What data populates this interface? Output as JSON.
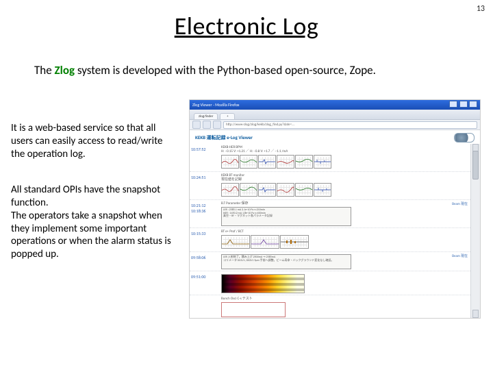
{
  "page_number": "13",
  "title": "Electronic Log",
  "intro_prefix": "The ",
  "intro_zlog": "Zlog",
  "intro_suffix": " system is developed with the Python-based open-source, Zope.",
  "para1": "It is a web-based service so that all users can easily access to read/write the operation log.",
  "para2": "All standard OPIs have the snapshot function.\nThe operators take a snapshot when they implement some important operations or when the alarm status is popped up.",
  "screenshot": {
    "window_title": "Zlog Viewer - Mozilla Firefox",
    "tab_label": "zlog.finder",
    "tab_plus": "+",
    "url": "http://www-zlog/zlog/kekb/zlog_find.py?date=...",
    "header_left": "KEKB 運転記録 e-Log Viewer",
    "entries": [
      {
        "ts": "10:57:52",
        "meta_line1": "KEKB-HER BPM",
        "meta_line2": "H: −0.15  V: +1.21  ／  H: −0.8  V: +1.7  ／  −1.1 /mA",
        "type": "plotgrid"
      },
      {
        "ts": "10:24:51",
        "meta_line1": "KEKB BT monitor",
        "meta_line2": "現在値を記録",
        "type": "plotgrid"
      },
      {
        "ts": "10:21:12",
        "ts2": "10:18:36",
        "meta_line1": "B.T Parameter 保存",
        "badge": "Beam 現在",
        "snap_text": "LER : 2585.1 mA  2.1e-10 Pa  τ=210min\nHER : 1450.2 mA  1.8e-10 Pa  τ=400min\n真空・RF・マグネット各パラメータ記録",
        "type": "snapshot"
      },
      {
        "ts": "10:15:33",
        "meta_line1": "BT e+ Prof / BCT",
        "type": "plotrow"
      },
      {
        "ts": "09:58:06",
        "badge": "Beam 現在",
        "snap_text": "LER 入射終了。積み上げ 2500mA → 2585mA\nコリメータ D01V1, D02V1 5μm 手前へ調整。ビーム寿命・バックグラウンド変化なし確認。",
        "type": "textonly"
      },
      {
        "ts": "09:51:00",
        "type": "heatmap"
      },
      {
        "ts": "",
        "meta_line1": "Bunch Osci C-s テスト",
        "type": "outline"
      }
    ]
  }
}
